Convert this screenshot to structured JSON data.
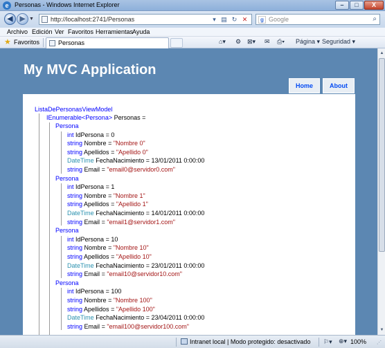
{
  "window": {
    "title": "Personas - Windows Internet Explorer",
    "controls": {
      "minimize": "–",
      "maximize": "□",
      "close": "X"
    }
  },
  "addressbar": {
    "url": "http://localhost:2741/Personas",
    "search_placeholder": "Google",
    "search_engine_glyph": "g"
  },
  "menu": [
    "Archivo",
    "Edición",
    "Ver",
    "Favoritos",
    "Herramientas",
    "Ayuda"
  ],
  "favorites": {
    "label": "Favoritos",
    "tab_title": "Personas"
  },
  "commandbar": {
    "page": "Página",
    "security": "Seguridad"
  },
  "site": {
    "title": "My MVC Application",
    "menu": {
      "home": "Home",
      "about": "About"
    }
  },
  "model": {
    "class_name": "ListaDePersonasViewModel",
    "collection_type_open": "IEnumerable",
    "collection_generic": "Persona",
    "collection_type_close": ">",
    "collection_name": "Personas =",
    "item_type": "Persona",
    "people": [
      {
        "id": "0",
        "nombre": "\"Nombre 0\"",
        "apellidos": "\"Apellido 0\"",
        "fecha": "13/01/2011 0:00:00",
        "email": "\"email0@servidor0.com\""
      },
      {
        "id": "1",
        "nombre": "\"Nombre 1\"",
        "apellidos": "\"Apellido 1\"",
        "fecha": "14/01/2011 0:00:00",
        "email": "\"email1@servidor1.com\""
      },
      {
        "id": "10",
        "nombre": "\"Nombre 10\"",
        "apellidos": "\"Apellido 10\"",
        "fecha": "23/01/2011 0:00:00",
        "email": "\"email10@servidor10.com\""
      },
      {
        "id": "100",
        "nombre": "\"Nombre 100\"",
        "apellidos": "\"Apellido 100\"",
        "fecha": "23/04/2011 0:00:00",
        "email": "\"email100@servidor100.com\""
      }
    ],
    "fields": {
      "int": "int",
      "string": "string",
      "datetime": "DateTime",
      "id": "IdPersona",
      "nombre": "Nombre",
      "apellidos": "Apellidos",
      "fecha": "FechaNacimiento",
      "email": "Email",
      "eq": "="
    }
  },
  "status": {
    "zone": "Intranet local | Modo protegido: desactivado",
    "zoom": "100%"
  },
  "colors": {
    "page_background": "#5c87b2",
    "menu_link": "#034af3",
    "keyword": "#0000ff",
    "type": "#2b91af",
    "string": "#a31515"
  }
}
